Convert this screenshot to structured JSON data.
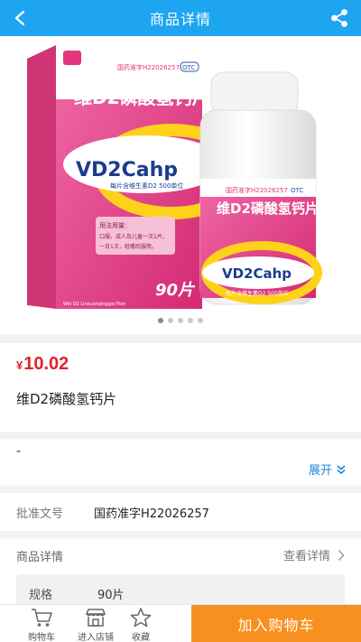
{
  "header": {
    "title": "商品详情"
  },
  "gallery": {
    "box": {
      "approval": "国药准字H22026257",
      "otc": "OTC",
      "cn_name": "维D2磷酸氢钙片",
      "brand": "VD2Cahp",
      "dose_line": "每片含维生素D2 500单位",
      "usage_title": "用法用量：",
      "usage_1": "口服，成人及儿童一次1片，",
      "usage_2": "一日1次，咀嚼后服用。",
      "count": "90片",
      "pinyin": "Wei D2 Linsuanqinggai Pian"
    },
    "bottle": {
      "approval": "国药准字H22026257",
      "otc": "OTC",
      "cn_name": "维D2磷酸氢钙片",
      "brand": "VD2Cahp",
      "dose_line": "每片含维生素D2 500单位"
    },
    "dots_count": 5,
    "active_dot": 0
  },
  "product": {
    "currency": "¥",
    "price": "10.02",
    "name": "维D2磷酸氢钙片"
  },
  "description": {
    "text": "-",
    "expand_label": "展开"
  },
  "approval": {
    "label": "批准文号",
    "value": "国药准字H22026257"
  },
  "details": {
    "label": "商品详情",
    "more_label": "查看详情",
    "spec_key": "规格",
    "spec_value": "90片"
  },
  "bottom_bar": {
    "cart": "购物车",
    "store": "进入店铺",
    "favorite": "收藏",
    "add_to_cart": "加入购物车"
  },
  "colors": {
    "header": "#1ea5f0",
    "price": "#e0232b",
    "link": "#1e88d8",
    "cart_button": "#f7901e",
    "box_pink": "#e2367f"
  }
}
